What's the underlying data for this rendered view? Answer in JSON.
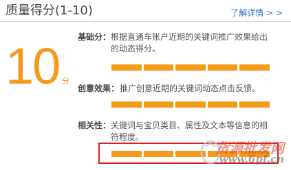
{
  "header": {
    "title": "质量得分(1-10)",
    "more_link": "了解详情 > >"
  },
  "score": {
    "value": "10",
    "unit": "分"
  },
  "items": [
    {
      "label": "基础分：",
      "desc_line1": "根据直通车账户近期的关键词推广效果给出",
      "desc_line2": "的动态得分。",
      "level_fraction": 1.0,
      "segments": 5
    },
    {
      "label": "创意效果：",
      "desc_line1": "推广创意近期的关键词动态点击反馈。",
      "desc_line2": "",
      "level_fraction": 1.0,
      "segments": 5
    },
    {
      "label": "相关性：",
      "desc_line1": "关键词与宝贝类目、属性及文本等信息的相",
      "desc_line2": "符程度。",
      "level_fraction": 1.0,
      "segments": 5
    }
  ],
  "watermark": {
    "text": "货源批发网",
    "url": "www.6pf.cn"
  },
  "colors": {
    "accent": "#f39a1a",
    "link": "#2f6fc0",
    "highlight": "#d81e1e"
  }
}
